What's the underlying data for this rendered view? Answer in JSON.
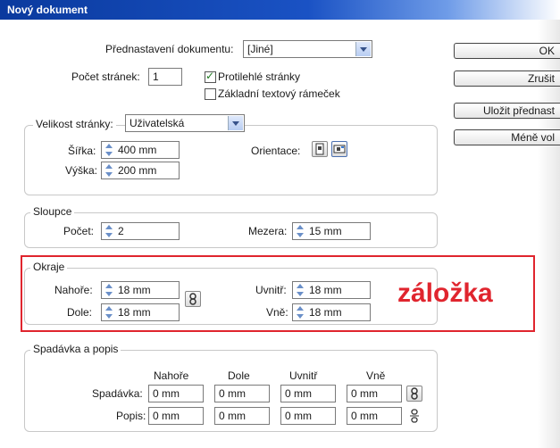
{
  "window": {
    "title": "Nový dokument"
  },
  "preset": {
    "label": "Přednastavení dokumentu:",
    "value": "[Jiné]"
  },
  "pages": {
    "count_label": "Počet stránek:",
    "count_value": "1",
    "facing_label": "Protilehlé stránky",
    "facing_checked": true,
    "master_frame_label": "Základní textový rámeček",
    "master_frame_checked": false
  },
  "page_size": {
    "title_label": "Velikost stránky:",
    "value": "Uživatelská",
    "width_label": "Šířka:",
    "width_value": "400 mm",
    "height_label": "Výška:",
    "height_value": "200 mm",
    "orientation_label": "Orientace:"
  },
  "columns": {
    "title": "Sloupce",
    "count_label": "Počet:",
    "count_value": "2",
    "gutter_label": "Mezera:",
    "gutter_value": "15 mm"
  },
  "margins": {
    "title": "Okraje",
    "top_label": "Nahoře:",
    "top_value": "18 mm",
    "bottom_label": "Dole:",
    "bottom_value": "18 mm",
    "inside_label": "Uvnitř:",
    "inside_value": "18 mm",
    "outside_label": "Vně:",
    "outside_value": "18 mm"
  },
  "bleed": {
    "title": "Spadávka a popis",
    "headers": [
      "Nahoře",
      "Dole",
      "Uvnitř",
      "Vně"
    ],
    "bleed_label": "Spadávka:",
    "bleed_values": [
      "0 mm",
      "0 mm",
      "0 mm",
      "0 mm"
    ],
    "slug_label": "Popis:",
    "slug_values": [
      "0 mm",
      "0 mm",
      "0 mm",
      "0 mm"
    ]
  },
  "buttons": {
    "ok": "OK",
    "cancel": "Zrušit",
    "save_preset": "Uložit přednast",
    "fewer_options": "Méně vol"
  },
  "annotation": {
    "text": "záložka",
    "color": "#e0252e"
  }
}
